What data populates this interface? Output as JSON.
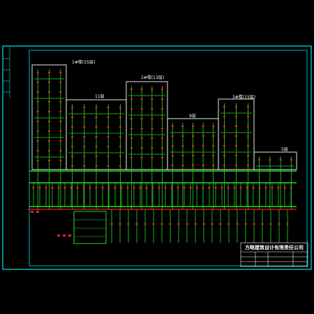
{
  "buildings": {
    "b1": {
      "label": "1#楼(15层)"
    },
    "b2": {
      "label": "11层"
    },
    "b3": {
      "label": "2#楼(13层)"
    },
    "b4": {
      "label": "9层"
    },
    "b5": {
      "label": "3#楼(15层)"
    },
    "b6": {
      "label": "5层"
    }
  },
  "title_block": {
    "company": "方略建筑设计有限责任公司"
  },
  "colors": {
    "frame": "#00e5e5",
    "wire_v": "#22dd22",
    "wire_h": "#22dd22",
    "tap": "#ee2222",
    "building": "#ffffff",
    "text": "#ffffff"
  }
}
